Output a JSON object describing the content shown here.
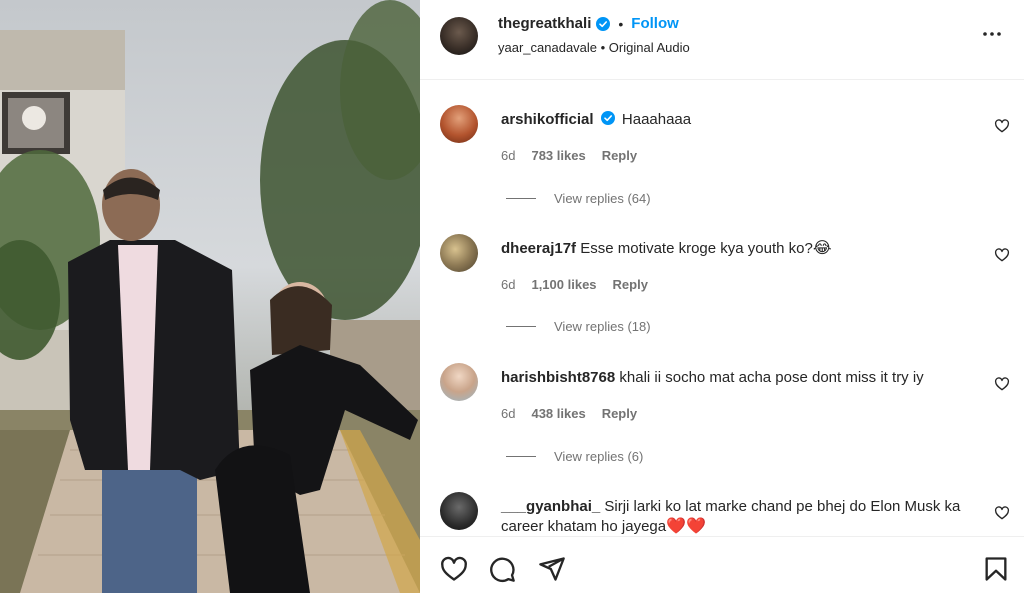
{
  "post": {
    "author": "thegreatkhali",
    "separator": "•",
    "follow_label": "Follow",
    "audio": "yaar_canadavale • Original Audio",
    "more_icon": "more-options-icon"
  },
  "comments": [
    {
      "username": "arshikofficial",
      "verified": true,
      "text": "Haaahaaa",
      "age": "6d",
      "likes": "783 likes",
      "reply_label": "Reply",
      "view_replies": "View replies (64)"
    },
    {
      "username": "dheeraj17f",
      "verified": false,
      "text": "Esse motivate kroge kya youth ko?",
      "emoji": "😂",
      "age": "6d",
      "likes": "1,100 likes",
      "reply_label": "Reply",
      "view_replies": "View replies (18)"
    },
    {
      "username": "harishbisht8768",
      "verified": false,
      "text": "khali ii socho mat acha pose dont miss it try iy",
      "age": "6d",
      "likes": "438 likes",
      "reply_label": "Reply",
      "view_replies": "View replies (6)"
    },
    {
      "username": "___gyanbhai_",
      "verified": false,
      "text": "Sirji larki ko lat marke chand pe bhej do Elon Musk ka career khatam ho jayega",
      "emoji": "❤️❤️"
    }
  ],
  "actions": {
    "like_icon": "heart-icon",
    "comment_icon": "comment-icon",
    "share_icon": "share-icon",
    "save_icon": "bookmark-icon"
  },
  "colors": {
    "accent": "#0095f6",
    "text": "#262626",
    "muted": "#737373",
    "heart_red": "#ed4956"
  }
}
